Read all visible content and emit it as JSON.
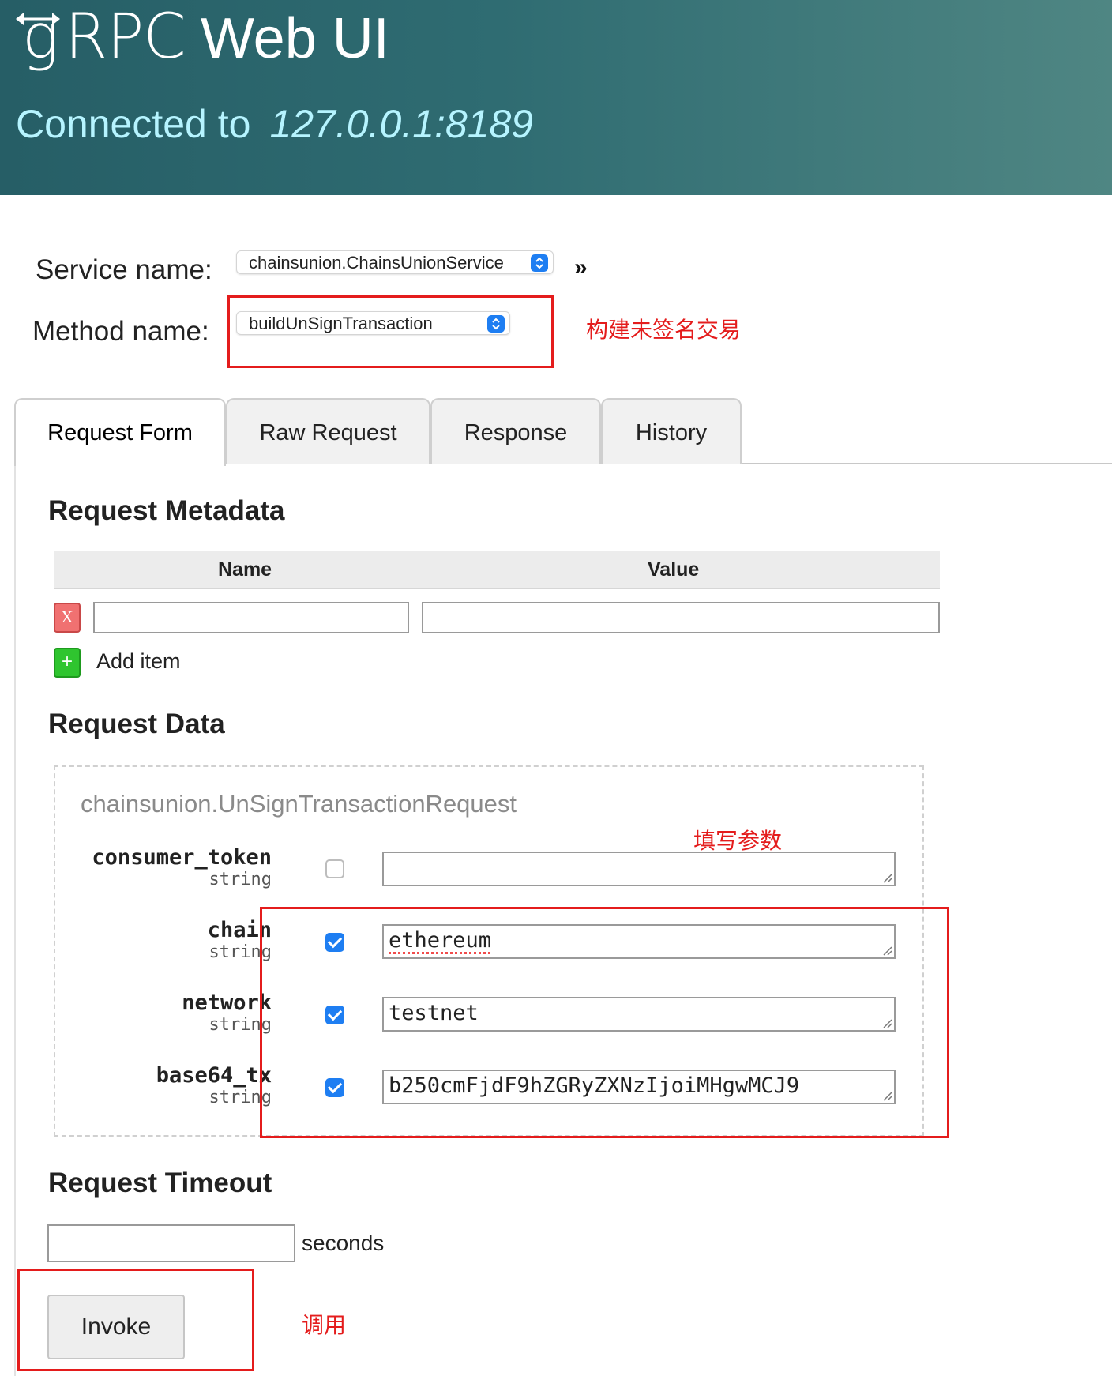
{
  "header": {
    "logo_g": "g",
    "logo_rpc": "RPC",
    "title": "Web UI",
    "connected_label": "Connected to",
    "address": "127.0.0.1:8189"
  },
  "selectors": {
    "service_label": "Service name:",
    "service_value": "chainsunion.ChainsUnionService",
    "method_label": "Method name:",
    "method_value": "buildUnSignTransaction",
    "expand_glyph": "»"
  },
  "annotations": {
    "method_note": "构建未签名交易",
    "params_note": "填写参数",
    "invoke_note": "调用"
  },
  "tabs": [
    {
      "label": "Request Form",
      "active": true
    },
    {
      "label": "Raw Request",
      "active": false
    },
    {
      "label": "Response",
      "active": false
    },
    {
      "label": "History",
      "active": false
    }
  ],
  "metadata": {
    "title": "Request Metadata",
    "col_name": "Name",
    "col_value": "Value",
    "remove_label": "X",
    "add_glyph": "+",
    "add_label": "Add item"
  },
  "request_data": {
    "title": "Request Data",
    "message_type": "chainsunion.UnSignTransactionRequest",
    "fields": [
      {
        "name": "consumer_token",
        "type": "string",
        "checked": false,
        "value": ""
      },
      {
        "name": "chain",
        "type": "string",
        "checked": true,
        "value": "ethereum"
      },
      {
        "name": "network",
        "type": "string",
        "checked": true,
        "value": "testnet"
      },
      {
        "name": "base64_tx",
        "type": "string",
        "checked": true,
        "value": "b250cmFjdF9hZGRyZXNzIjoiMHgwMCJ9"
      }
    ]
  },
  "timeout": {
    "title": "Request Timeout",
    "value": "",
    "unit": "seconds"
  },
  "invoke": {
    "label": "Invoke"
  },
  "colors": {
    "header_start": "#265e66",
    "header_end": "#4f8683",
    "address_color": "#b6f4ff",
    "annotation_red": "#e41c1c",
    "checkbox_blue": "#1e7ef2"
  }
}
